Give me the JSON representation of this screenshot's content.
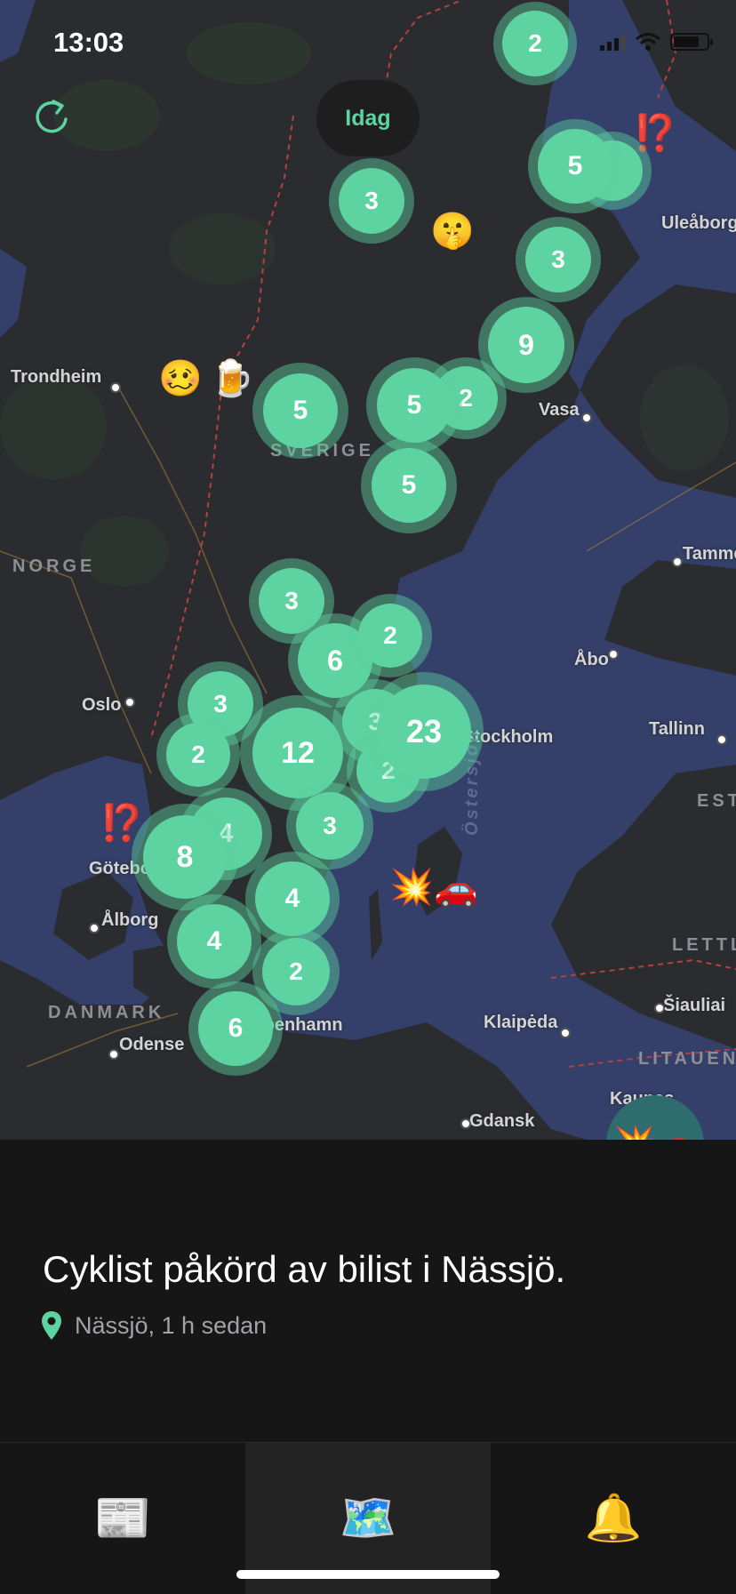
{
  "status_bar": {
    "time": "13:03"
  },
  "map": {
    "today_filter_label": "Idag",
    "places": [
      {
        "name": "Trondheim"
      },
      {
        "name": "Uleåborg"
      },
      {
        "name": "Vasa"
      },
      {
        "name": "Tammerfors"
      },
      {
        "name": "Åbo"
      },
      {
        "name": "Oslo"
      },
      {
        "name": "Stockholm"
      },
      {
        "name": "Tallinn"
      },
      {
        "name": "Göteborg"
      },
      {
        "name": "Ålborg"
      },
      {
        "name": "Odense"
      },
      {
        "name": "Köpenhamn"
      },
      {
        "name": "Klaipėda"
      },
      {
        "name": "Šiauliai"
      },
      {
        "name": "Kaunas"
      },
      {
        "name": "Gdansk"
      }
    ],
    "countries": [
      "SVERIGE",
      "NORGE",
      "DANMARK",
      "LITAUEN",
      "LETTLAND",
      "ESTLAND"
    ],
    "sea_label": "Östersjön",
    "clusters": [
      "2",
      "5",
      "3",
      "3",
      "3",
      "9",
      "5",
      "2",
      "5",
      "5",
      "3",
      "6",
      "2",
      "3",
      "2",
      "12",
      "3",
      "23",
      "2",
      "3",
      "4",
      "8",
      "4",
      "4",
      "2",
      "6"
    ],
    "emoji_markers": [
      "⁉️",
      "🤫",
      "🥴",
      "🍺",
      "⁉️",
      "💥",
      "🚗"
    ],
    "selected_marker_emoji": "💥🚗"
  },
  "event": {
    "title": "Cyklist påkörd av bilist i Nässjö.",
    "location_time": "Nässjö, 1 h sedan"
  },
  "tabs": [
    {
      "name": "news",
      "icon": "📰"
    },
    {
      "name": "map",
      "icon": "🗺️"
    },
    {
      "name": "notifications",
      "icon": "🔔"
    }
  ],
  "colors": {
    "accent": "#5cd3a0",
    "sea": "#34406a",
    "land": "#2a2c30",
    "background": "#161616"
  }
}
